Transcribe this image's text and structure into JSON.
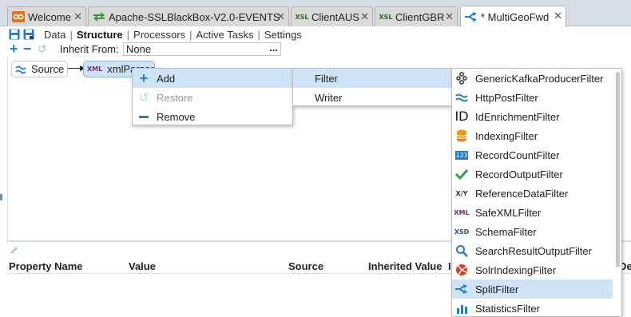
{
  "tabs": [
    {
      "label": "Welcome",
      "icon": "welcome-icon"
    },
    {
      "label": "Apache-SSLBlackBox-V2.0-EVENTS",
      "icon": "feed-icon"
    },
    {
      "label": "ClientAUS",
      "icon": "xsl-icon"
    },
    {
      "label": "ClientGBR",
      "icon": "xsl-icon"
    },
    {
      "label": "* MultiGeoFwd",
      "icon": "pipeline-icon"
    }
  ],
  "tab_icon_text": {
    "xsl": "XSL",
    "xml": "XML",
    "xsd": "XSD",
    "xy": "X/Y",
    "num": "123",
    "id": "ID"
  },
  "nav": {
    "items": [
      "Data",
      "Structure",
      "Processors",
      "Active Tasks",
      "Settings"
    ],
    "separator": "|"
  },
  "inherit": {
    "label": "Inherit From:",
    "value": "None",
    "button": "..."
  },
  "nodes": {
    "source": "Source",
    "xmlparser": "xmlParser"
  },
  "context_menu": {
    "items": [
      {
        "label": "Add",
        "icon": "plus-icon"
      },
      {
        "label": "Restore",
        "icon": "restore-icon",
        "disabled": true
      },
      {
        "label": "Remove",
        "icon": "minus-icon"
      }
    ]
  },
  "submenu": {
    "items": [
      "Filter",
      "Writer"
    ]
  },
  "filters": [
    "GenericKafkaProducerFilter",
    "HttpPostFilter",
    "IdEnrichmentFilter",
    "IndexingFilter",
    "RecordCountFilter",
    "RecordOutputFilter",
    "ReferenceDataFilter",
    "SafeXMLFilter",
    "SchemaFilter",
    "SearchResultOutputFilter",
    "SolrIndexingFilter",
    "SplitFilter",
    "StatisticsFilter"
  ],
  "properties": {
    "headers": [
      "Property Name",
      "Value",
      "Source",
      "Inherited Value",
      "In",
      "Desc"
    ]
  },
  "colors": {
    "accent": "#1b7fd8",
    "highlight": "#cfe3f7",
    "tabbar": "#d6dde6"
  }
}
